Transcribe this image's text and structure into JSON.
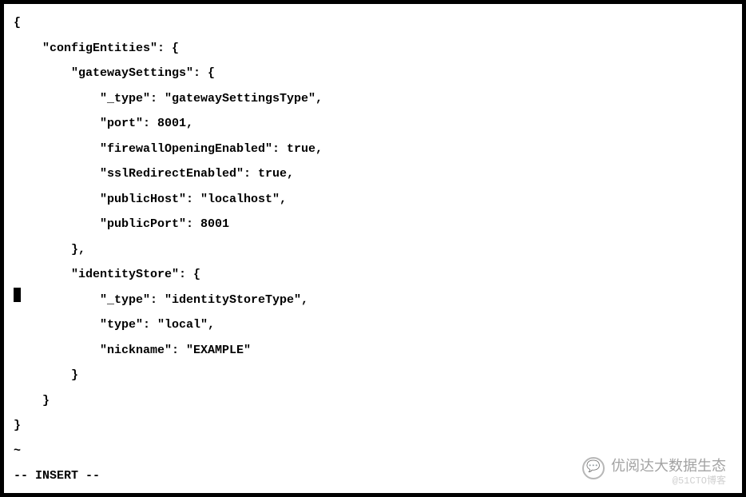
{
  "editor": {
    "lines": [
      "{",
      "    \"configEntities\": {",
      "        \"gatewaySettings\": {",
      "            \"_type\": \"gatewaySettingsType\",",
      "            \"port\": 8001,",
      "            \"firewallOpeningEnabled\": true,",
      "            \"sslRedirectEnabled\": true,",
      "            \"publicHost\": \"localhost\",",
      "            \"publicPort\": 8001",
      "        },",
      "        \"identityStore\": {",
      "            \"_type\": \"identityStoreType\",",
      "            \"type\": \"local\",",
      "            \"nickname\": \"EXAMPLE\"",
      "        }",
      "    }",
      "}"
    ],
    "tilde": "~",
    "status": "-- INSERT --",
    "cursor_line": 11
  },
  "watermark": {
    "text": "优阅达大数据生态",
    "sub": "@51CTO博客"
  },
  "config_content": {
    "configEntities": {
      "gatewaySettings": {
        "_type": "gatewaySettingsType",
        "port": 8001,
        "firewallOpeningEnabled": true,
        "sslRedirectEnabled": true,
        "publicHost": "localhost",
        "publicPort": 8001
      },
      "identityStore": {
        "_type": "identityStoreType",
        "type": "local",
        "nickname": "EXAMPLE"
      }
    }
  }
}
